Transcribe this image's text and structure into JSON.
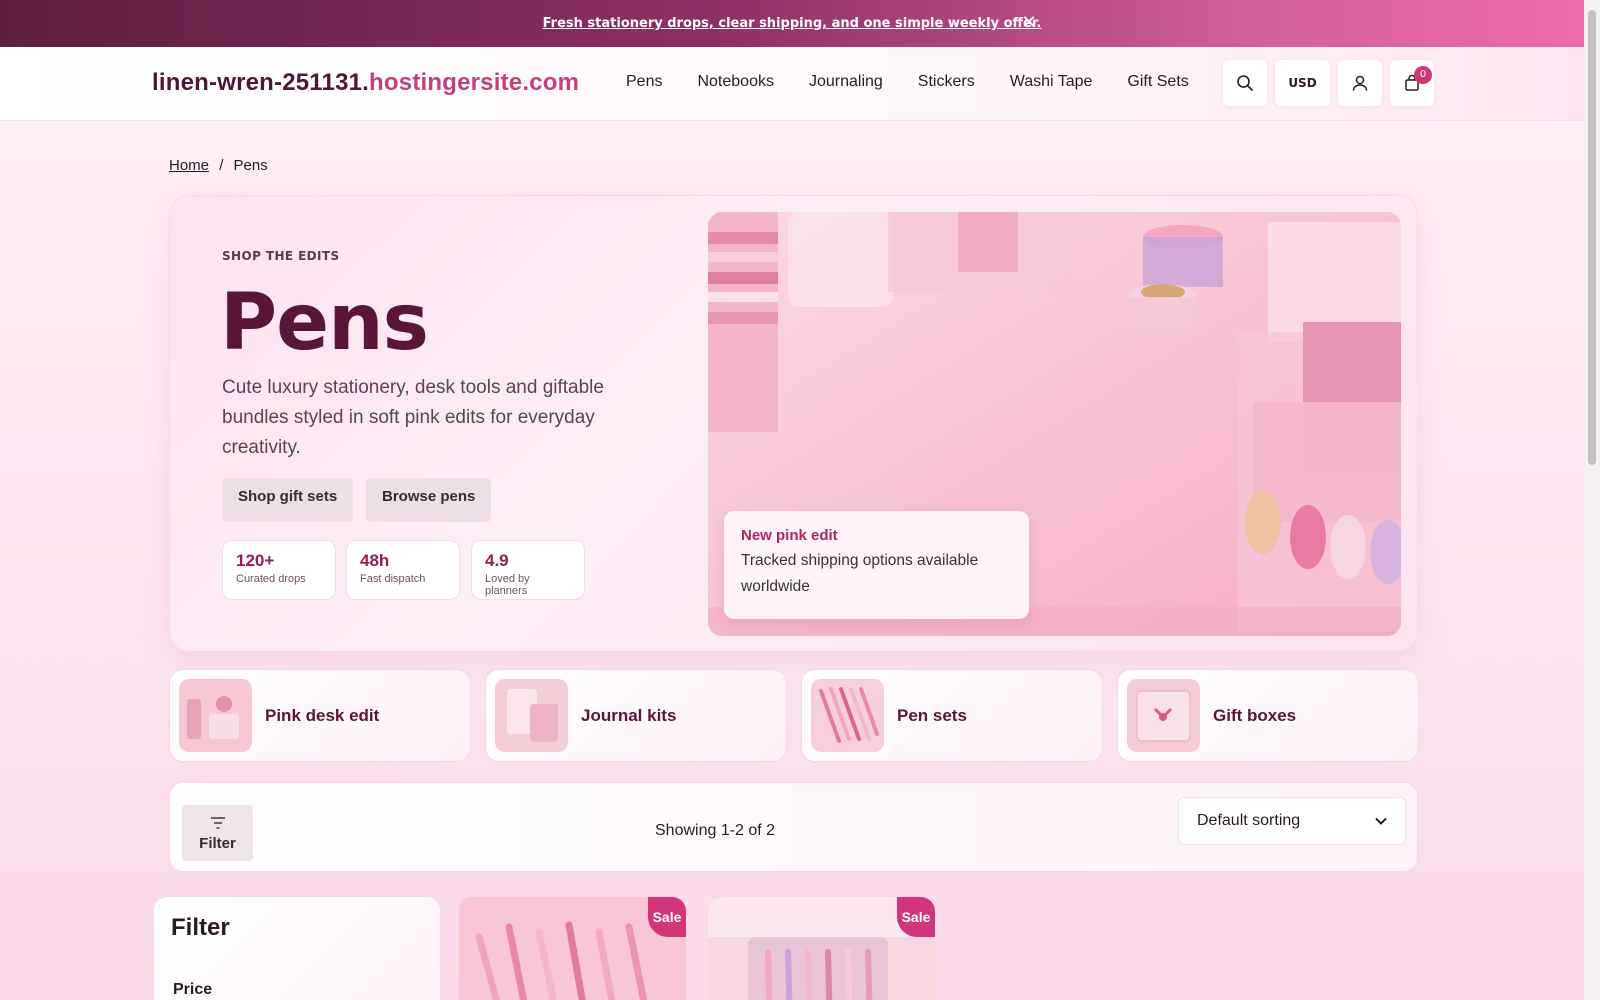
{
  "announcement": {
    "text": "Fresh stationery drops, clear shipping, and one simple weekly offer.",
    "close_glyph": "✕"
  },
  "header": {
    "brand_name": "linen-wren-251131.",
    "brand_tld": "hostingersite.com",
    "nav": [
      "Pens",
      "Notebooks",
      "Journaling",
      "Stickers",
      "Washi Tape",
      "Gift Sets"
    ],
    "currency": "USD",
    "cart_count": "0"
  },
  "breadcrumb": {
    "home": "Home",
    "separator": "/",
    "current": "Pens"
  },
  "hero": {
    "kicker": "SHOP THE EDITS",
    "title": "Pens",
    "description": "Cute luxury stationery, desk tools and giftable bundles styled in soft pink edits for everyday creativity.",
    "buttons": [
      "Shop gift sets",
      "Browse pens"
    ],
    "stats": [
      {
        "value": "120+",
        "label": "Curated drops"
      },
      {
        "value": "48h",
        "label": "Fast dispatch"
      },
      {
        "value": "4.9",
        "label": "Loved by planners"
      }
    ],
    "card": {
      "title": "New pink edit",
      "text": "Tracked shipping options available worldwide"
    }
  },
  "categories": [
    "Pink desk edit",
    "Journal kits",
    "Pen sets",
    "Gift boxes"
  ],
  "toolbar": {
    "filter_label": "Filter",
    "showing": "Showing 1-2 of 2",
    "sort_value": "Default sorting"
  },
  "filter_panel": {
    "title": "Filter",
    "price_label": "Price"
  },
  "products": [
    {
      "badge": "Sale"
    },
    {
      "badge": "Sale"
    }
  ],
  "colors": {
    "accent": "#d2357a",
    "brand_dark": "#5a1638",
    "banner_start": "#5e1f3f",
    "banner_end": "#f06aa8"
  }
}
